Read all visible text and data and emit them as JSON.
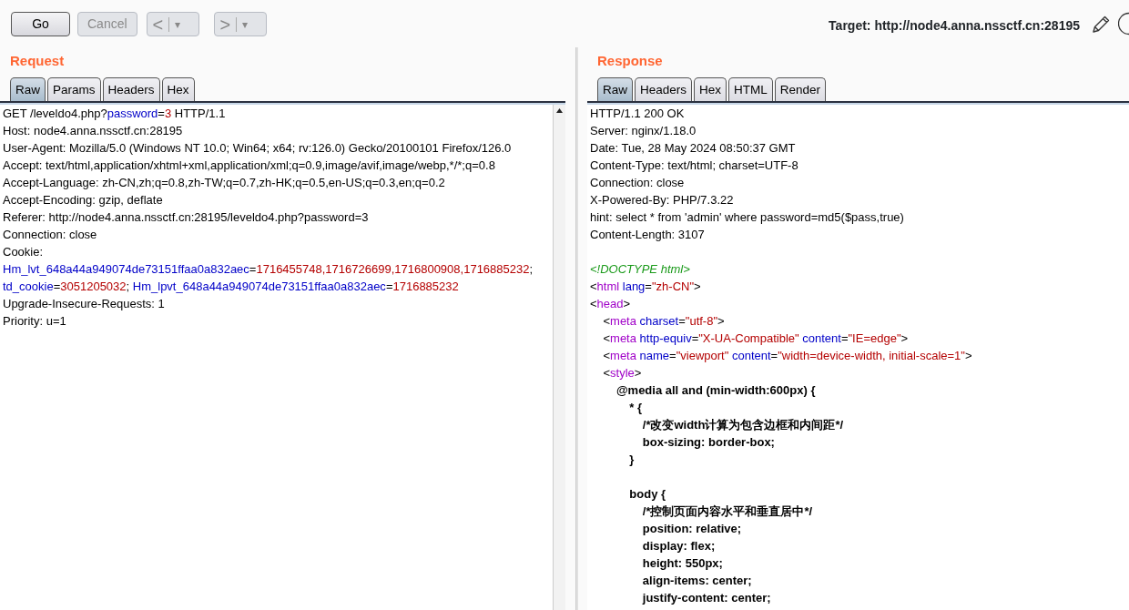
{
  "toolbar": {
    "buttons": [
      {
        "label": "Go",
        "disabled": false
      },
      {
        "label": "Cancel",
        "disabled": true
      }
    ],
    "history": [
      {
        "label": "<",
        "menu": "▾",
        "disabled": true
      },
      {
        "label": ">",
        "menu": "▾",
        "disabled": true
      }
    ],
    "target": "Target: http://node4.anna.nssctf.cn:28195"
  },
  "panels": [
    {
      "title": "Request",
      "tabs": [
        {
          "label": "Raw",
          "selected": true
        },
        {
          "label": "Params",
          "selected": false
        },
        {
          "label": "Headers",
          "selected": false
        },
        {
          "label": "Hex",
          "selected": false
        }
      ],
      "lines": [
        {
          "kind": "code",
          "segments": [
            {
              "kind": "plain",
              "t": "GET /leveldo4.php?"
            },
            {
              "kind": "key",
              "t": "password"
            },
            {
              "kind": "plain",
              "t": "="
            },
            {
              "kind": "value",
              "t": "3"
            },
            {
              "kind": "plain",
              "t": " HTTP/1.1"
            }
          ]
        },
        {
          "kind": "code",
          "segments": [
            {
              "kind": "plain",
              "t": "Host: node4.anna.nssctf.cn:28195"
            }
          ]
        },
        {
          "kind": "code",
          "segments": [
            {
              "kind": "plain",
              "t": "User-Agent: Mozilla/5.0 (Windows NT 10.0; Win64; x64; rv:126.0) Gecko/20100101 Firefox/126.0"
            }
          ]
        },
        {
          "kind": "code",
          "segments": [
            {
              "kind": "plain",
              "t": "Accept: text/html,application/xhtml+xml,application/xml;q=0.9,image/avif,image/webp,*/*;q=0.8"
            }
          ]
        },
        {
          "kind": "code",
          "segments": [
            {
              "kind": "plain",
              "t": "Accept-Language: zh-CN,zh;q=0.8,zh-TW;q=0.7,zh-HK;q=0.5,en-US;q=0.3,en;q=0.2"
            }
          ]
        },
        {
          "kind": "code",
          "segments": [
            {
              "kind": "plain",
              "t": "Accept-Encoding: gzip, deflate"
            }
          ]
        },
        {
          "kind": "code",
          "segments": [
            {
              "kind": "plain",
              "t": "Referer: http://node4.anna.nssctf.cn:28195/leveldo4.php?password=3"
            }
          ]
        },
        {
          "kind": "code",
          "segments": [
            {
              "kind": "plain",
              "t": "Connection: close"
            }
          ]
        },
        {
          "kind": "code",
          "segments": [
            {
              "kind": "plain",
              "t": "Cookie:"
            }
          ]
        },
        {
          "kind": "code",
          "segments": [
            {
              "kind": "key",
              "t": "Hm_lvt_648a44a949074de73151ffaa0a832aec"
            },
            {
              "kind": "plain",
              "t": "="
            },
            {
              "kind": "value",
              "t": "1716455748,1716726699,1716800908,1716885232"
            },
            {
              "kind": "plain",
              "t": ";"
            }
          ]
        },
        {
          "kind": "code",
          "segments": [
            {
              "kind": "key",
              "t": "td_cookie"
            },
            {
              "kind": "plain",
              "t": "="
            },
            {
              "kind": "value",
              "t": "3051205032"
            },
            {
              "kind": "plain",
              "t": ";"
            },
            {
              "kind": "key",
              "t": " Hm_lpvt_648a44a949074de73151ffaa0a832aec"
            },
            {
              "kind": "plain",
              "t": "="
            },
            {
              "kind": "value",
              "t": "1716885232"
            }
          ]
        },
        {
          "kind": "code",
          "segments": [
            {
              "kind": "plain",
              "t": "Upgrade-Insecure-Requests: 1"
            }
          ]
        },
        {
          "kind": "code",
          "segments": [
            {
              "kind": "plain",
              "t": "Priority: u=1"
            }
          ]
        }
      ]
    },
    {
      "title": "Response",
      "tabs": [
        {
          "label": "Raw",
          "selected": true
        },
        {
          "label": "Headers",
          "selected": false
        },
        {
          "label": "Hex",
          "selected": false
        },
        {
          "label": "HTML",
          "selected": false
        },
        {
          "label": "Render",
          "selected": false
        }
      ],
      "lines": [
        {
          "kind": "code",
          "segments": [
            {
              "kind": "plain",
              "t": "HTTP/1.1 200 OK"
            }
          ]
        },
        {
          "kind": "code",
          "segments": [
            {
              "kind": "plain",
              "t": "Server: nginx/1.18.0"
            }
          ]
        },
        {
          "kind": "code",
          "segments": [
            {
              "kind": "plain",
              "t": "Date: Tue, 28 May 2024 08:50:37 GMT"
            }
          ]
        },
        {
          "kind": "code",
          "segments": [
            {
              "kind": "plain",
              "t": "Content-Type: text/html; charset=UTF-8"
            }
          ]
        },
        {
          "kind": "code",
          "segments": [
            {
              "kind": "plain",
              "t": "Connection: close"
            }
          ]
        },
        {
          "kind": "code",
          "segments": [
            {
              "kind": "plain",
              "t": "X-Powered-By: PHP/7.3.22"
            }
          ]
        },
        {
          "kind": "code",
          "segments": [
            {
              "kind": "plain",
              "t": "hint: select * from 'admin' where password=md5($pass,true)"
            }
          ]
        },
        {
          "kind": "code",
          "segments": [
            {
              "kind": "plain",
              "t": "Content-Length: 3107"
            }
          ]
        },
        {
          "kind": "blank"
        },
        {
          "kind": "code",
          "segments": [
            {
              "kind": "doctype",
              "t": "<!DOCTYPE html>"
            }
          ]
        },
        {
          "kind": "code",
          "segments": [
            {
              "kind": "plain",
              "t": "<"
            },
            {
              "kind": "tag",
              "t": "html"
            },
            {
              "kind": "key",
              "t": " lang"
            },
            {
              "kind": "plain",
              "t": "="
            },
            {
              "kind": "value",
              "t": "\"zh-CN\""
            },
            {
              "kind": "plain",
              "t": ">"
            }
          ]
        },
        {
          "kind": "code",
          "segments": [
            {
              "kind": "plain",
              "t": "<"
            },
            {
              "kind": "tag",
              "t": "head"
            },
            {
              "kind": "plain",
              "t": ">"
            }
          ]
        },
        {
          "kind": "code",
          "segments": [
            {
              "kind": "plain",
              "t": "    <"
            },
            {
              "kind": "tag",
              "t": "meta"
            },
            {
              "kind": "key",
              "t": " charset"
            },
            {
              "kind": "plain",
              "t": "="
            },
            {
              "kind": "value",
              "t": "\"utf-8\""
            },
            {
              "kind": "plain",
              "t": ">"
            }
          ]
        },
        {
          "kind": "code",
          "segments": [
            {
              "kind": "plain",
              "t": "    <"
            },
            {
              "kind": "tag",
              "t": "meta"
            },
            {
              "kind": "key",
              "t": " http-equiv"
            },
            {
              "kind": "plain",
              "t": "="
            },
            {
              "kind": "value",
              "t": "\"X-UA-Compatible\""
            },
            {
              "kind": "key",
              "t": " content"
            },
            {
              "kind": "plain",
              "t": "="
            },
            {
              "kind": "value",
              "t": "\"IE=edge\""
            },
            {
              "kind": "plain",
              "t": ">"
            }
          ]
        },
        {
          "kind": "code",
          "segments": [
            {
              "kind": "plain",
              "t": "    <"
            },
            {
              "kind": "tag",
              "t": "meta"
            },
            {
              "kind": "key",
              "t": " name"
            },
            {
              "kind": "plain",
              "t": "="
            },
            {
              "kind": "value",
              "t": "\"viewport\""
            },
            {
              "kind": "key",
              "t": " content"
            },
            {
              "kind": "plain",
              "t": "="
            },
            {
              "kind": "value",
              "t": "\"width=device-width, initial-scale=1\""
            },
            {
              "kind": "plain",
              "t": ">"
            }
          ]
        },
        {
          "kind": "code",
          "segments": [
            {
              "kind": "plain",
              "t": "    <"
            },
            {
              "kind": "tag",
              "t": "style"
            },
            {
              "kind": "plain",
              "t": ">"
            }
          ]
        },
        {
          "kind": "code",
          "segments": [
            {
              "kind": "css",
              "t": "        @media all and (min-width:600px) {"
            }
          ]
        },
        {
          "kind": "code",
          "segments": [
            {
              "kind": "css",
              "t": "            * {"
            }
          ]
        },
        {
          "kind": "code",
          "segments": [
            {
              "kind": "css",
              "t": "                /*改变width计算为包含边框和内间距*/"
            }
          ]
        },
        {
          "kind": "code",
          "segments": [
            {
              "kind": "css",
              "t": "                box-sizing: border-box;"
            }
          ]
        },
        {
          "kind": "code",
          "segments": [
            {
              "kind": "css",
              "t": "            }"
            }
          ]
        },
        {
          "kind": "blank"
        },
        {
          "kind": "code",
          "segments": [
            {
              "kind": "css",
              "t": "            body {"
            }
          ]
        },
        {
          "kind": "code",
          "segments": [
            {
              "kind": "css",
              "t": "                /*控制页面内容水平和垂直居中*/"
            }
          ]
        },
        {
          "kind": "code",
          "segments": [
            {
              "kind": "css",
              "t": "                position: relative;"
            }
          ]
        },
        {
          "kind": "code",
          "segments": [
            {
              "kind": "css",
              "t": "                display: flex;"
            }
          ]
        },
        {
          "kind": "code",
          "segments": [
            {
              "kind": "css",
              "t": "                height: 550px;"
            }
          ]
        },
        {
          "kind": "code",
          "segments": [
            {
              "kind": "css",
              "t": "                align-items: center;"
            }
          ]
        },
        {
          "kind": "code",
          "segments": [
            {
              "kind": "css",
              "t": "                justify-content: center;"
            }
          ]
        }
      ]
    }
  ]
}
